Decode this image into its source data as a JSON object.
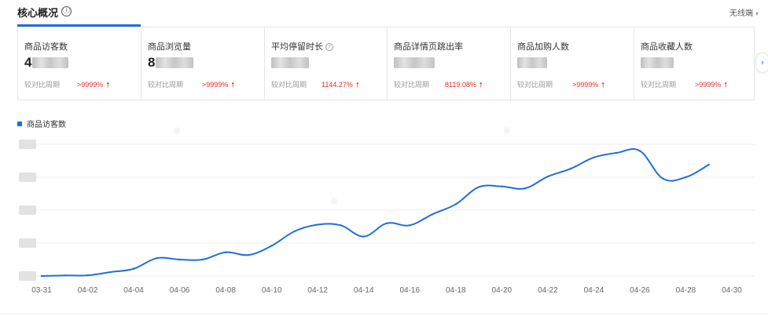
{
  "header": {
    "title": "核心概况",
    "info_icon": "ⓘ",
    "platform": "无线端"
  },
  "cards": [
    {
      "name": "商品访客数",
      "value_prefix": "4",
      "compare_label": "较对比周期",
      "delta": ">9999%",
      "active": true
    },
    {
      "name": "商品浏览量",
      "value_prefix": "8",
      "compare_label": "较对比周期",
      "delta": ">9999%"
    },
    {
      "name": "平均停留时长",
      "value_prefix": "",
      "compare_label": "较对比周期",
      "delta": "1144.27%",
      "has_help": true
    },
    {
      "name": "商品详情页跳出率",
      "value_prefix": "",
      "compare_label": "较对比周期",
      "delta": "8119.08%"
    },
    {
      "name": "商品加购人数",
      "value_prefix": "",
      "compare_label": "较对比周期",
      "delta": ">9999%"
    },
    {
      "name": "商品收藏人数",
      "value_prefix": "",
      "compare_label": "较对比周期",
      "delta": ">9999%"
    }
  ],
  "colors": {
    "accent": "#1f6fd9",
    "up": "#e52d2d",
    "grid": "#eeeeee"
  },
  "icons": {
    "info": "info-icon",
    "help": "question-icon",
    "next": "chevron-right-icon",
    "up": "arrow-up-icon"
  },
  "chart_data": {
    "type": "line",
    "legend": "商品访客数",
    "legend_position": "top-left",
    "y_tick_labels_visible": false,
    "grid": true,
    "x": [
      "03-31",
      "04-01",
      "04-02",
      "04-03",
      "04-04",
      "04-05",
      "04-06",
      "04-07",
      "04-08",
      "04-09",
      "04-10",
      "04-11",
      "04-12",
      "04-13",
      "04-14",
      "04-15",
      "04-16",
      "04-17",
      "04-18",
      "04-19",
      "04-20",
      "04-21",
      "04-22",
      "04-23",
      "04-24",
      "04-25",
      "04-26",
      "04-27",
      "04-28",
      "04-29",
      "04-30"
    ],
    "x_tick_labels": [
      "03-31",
      "04-02",
      "04-04",
      "04-06",
      "04-08",
      "04-10",
      "04-12",
      "04-14",
      "04-16",
      "04-18",
      "04-20",
      "04-22",
      "04-24",
      "04-26",
      "04-28",
      "04-30"
    ],
    "series": [
      {
        "name": "商品访客数",
        "values": [
          0.0,
          0.4,
          0.5,
          3.0,
          5.5,
          13.5,
          12.5,
          12.5,
          18.0,
          16.0,
          23.0,
          34.0,
          39.0,
          38.5,
          30.0,
          40.0,
          38.5,
          47.0,
          54.5,
          67.5,
          68.0,
          66.5,
          75.5,
          81.5,
          90.0,
          93.5,
          95.0,
          74.0,
          75.0,
          84.5
        ]
      }
    ],
    "ylim": [
      0,
      100
    ]
  }
}
